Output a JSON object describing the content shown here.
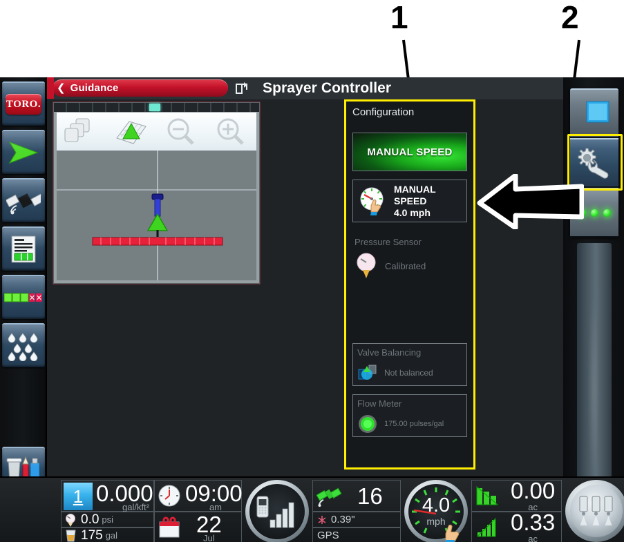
{
  "callouts": [
    {
      "label": "1",
      "target": "configuration-panel"
    },
    {
      "label": "2",
      "target": "settings-gear-button"
    }
  ],
  "header": {
    "guidance_tab_label": "Guidance",
    "back_chevron": "back-chevron-icon",
    "share_icon": "share-screen-icon",
    "title": "Sprayer Controller"
  },
  "map": {
    "toolbar_icons": [
      "layers-icon",
      "field-map-icon",
      "zoom-out-icon",
      "zoom-in-icon"
    ],
    "vehicle_icon": "sprayer-vehicle-icon",
    "boom_icon": "spray-boom-icon"
  },
  "left_rail": {
    "items": [
      {
        "name": "toro-logo",
        "label": "TORO."
      },
      {
        "name": "guidance-arrow-icon",
        "label": ""
      },
      {
        "name": "gps-satellite-icon",
        "label": ""
      },
      {
        "name": "job-report-icon",
        "label": ""
      },
      {
        "name": "section-status-icon",
        "label": ""
      },
      {
        "name": "spray-rate-icon",
        "label": ""
      },
      {
        "name": "data-manager-icon",
        "label": ""
      },
      {
        "name": "tools-wrench-icon",
        "label": ""
      }
    ]
  },
  "right_rail": {
    "items": [
      {
        "name": "display-screen-button",
        "label": ""
      },
      {
        "name": "settings-gear-button",
        "label": "",
        "selected": true
      },
      {
        "name": "section-leds-button",
        "label": ""
      }
    ],
    "led_count": 3,
    "highlight_color": "#ffee00"
  },
  "config": {
    "title": "Configuration",
    "manual_speed_button": {
      "label": "MANUAL SPEED",
      "state": "active",
      "color": "#1ea81c"
    },
    "manual_speed_value": {
      "icon": "speed-dial-hand-icon",
      "line1": "MANUAL",
      "line2": "SPEED",
      "line3": "4.0 mph"
    },
    "pressure_sensor": {
      "title": "Pressure Sensor",
      "icon": "pressure-gauge-icon",
      "status": "Calibrated"
    },
    "valve_balancing": {
      "title": "Valve Balancing",
      "icon": "valve-balance-icon",
      "status": "Not balanced"
    },
    "flow_meter": {
      "title": "Flow Meter",
      "icon": "flow-meter-icon",
      "status": "175.00 pulses/gal"
    }
  },
  "statusbar": {
    "rate": {
      "preset": "1",
      "value": "0.000",
      "unit": "gal/kft²"
    },
    "pressure": {
      "icon": "pressure-small-icon",
      "value": "0.0",
      "unit": "psi"
    },
    "tank": {
      "icon": "tank-level-icon",
      "value": "175",
      "unit": "gal"
    },
    "clock": {
      "icon": "clock-icon",
      "value": "09:00",
      "unit": "am"
    },
    "date": {
      "icon": "calendar-icon",
      "value": "22",
      "unit": "Jul"
    },
    "signal": {
      "icon": "cell-signal-icon"
    },
    "gps": {
      "satellite_icon": "gps-satellite-icon",
      "satellites": "16",
      "accuracy_icon": "accuracy-icon",
      "accuracy": "0.39\"",
      "label": "GPS"
    },
    "speed": {
      "value": "4.0",
      "unit": "mph",
      "icon": "hand-touch-icon"
    },
    "area_total": {
      "icon": "area-bars-icon",
      "value": "0.00",
      "unit": "ac"
    },
    "area_applied": {
      "icon": "area-bars-icon",
      "value": "0.33",
      "unit": "ac"
    },
    "boom_button": {
      "icon": "boom-sections-icon"
    }
  }
}
